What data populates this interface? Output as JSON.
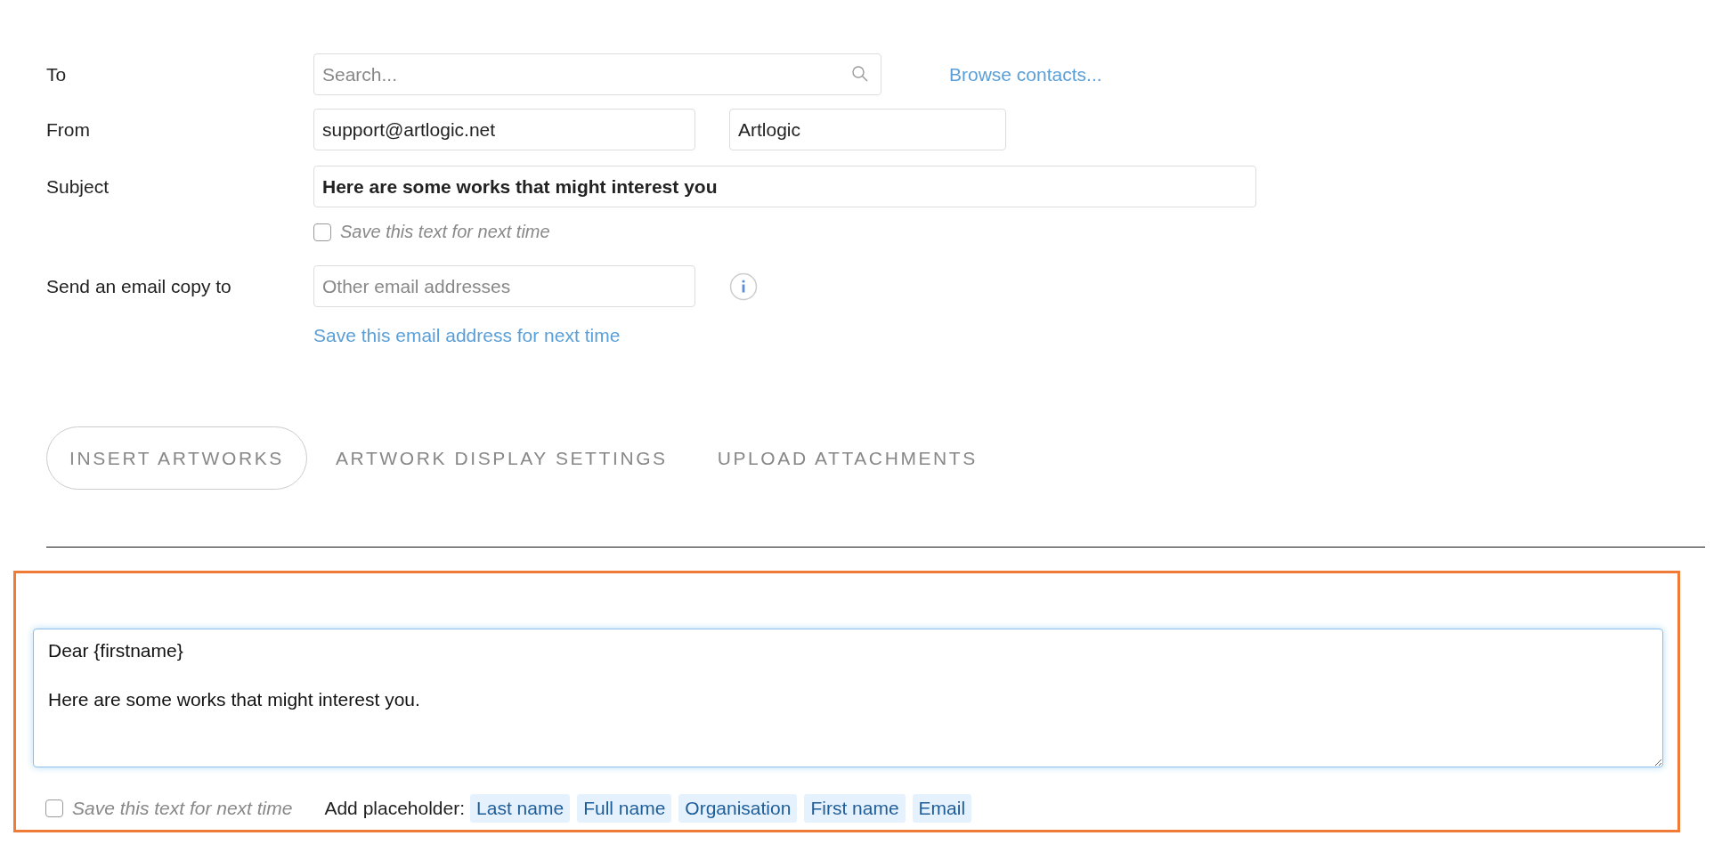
{
  "to": {
    "label": "To",
    "placeholder": "Search...",
    "browse_link": "Browse contacts..."
  },
  "from": {
    "label": "From",
    "email": "support@artlogic.net",
    "name": "Artlogic"
  },
  "subject": {
    "label": "Subject",
    "value": "Here are some works that might interest you",
    "save_checkbox": {
      "label": "Save this text for next time",
      "checked": false
    }
  },
  "copy_to": {
    "label": "Send an email copy to",
    "placeholder": "Other email addresses",
    "save_link": "Save this email address for next time"
  },
  "tabs": [
    {
      "label": "INSERT ARTWORKS",
      "selected": true
    },
    {
      "label": "ARTWORK DISPLAY SETTINGS",
      "selected": false
    },
    {
      "label": "UPLOAD ATTACHMENTS",
      "selected": false
    }
  ],
  "editor": {
    "body": "Dear {firstname}\n\nHere are some works that might interest you.",
    "save_checkbox": {
      "label": "Save this text for next time",
      "checked": false
    },
    "placeholder_label": "Add placeholder:",
    "placeholders": [
      "Last name",
      "Full name",
      "Organisation",
      "First name",
      "Email"
    ]
  }
}
